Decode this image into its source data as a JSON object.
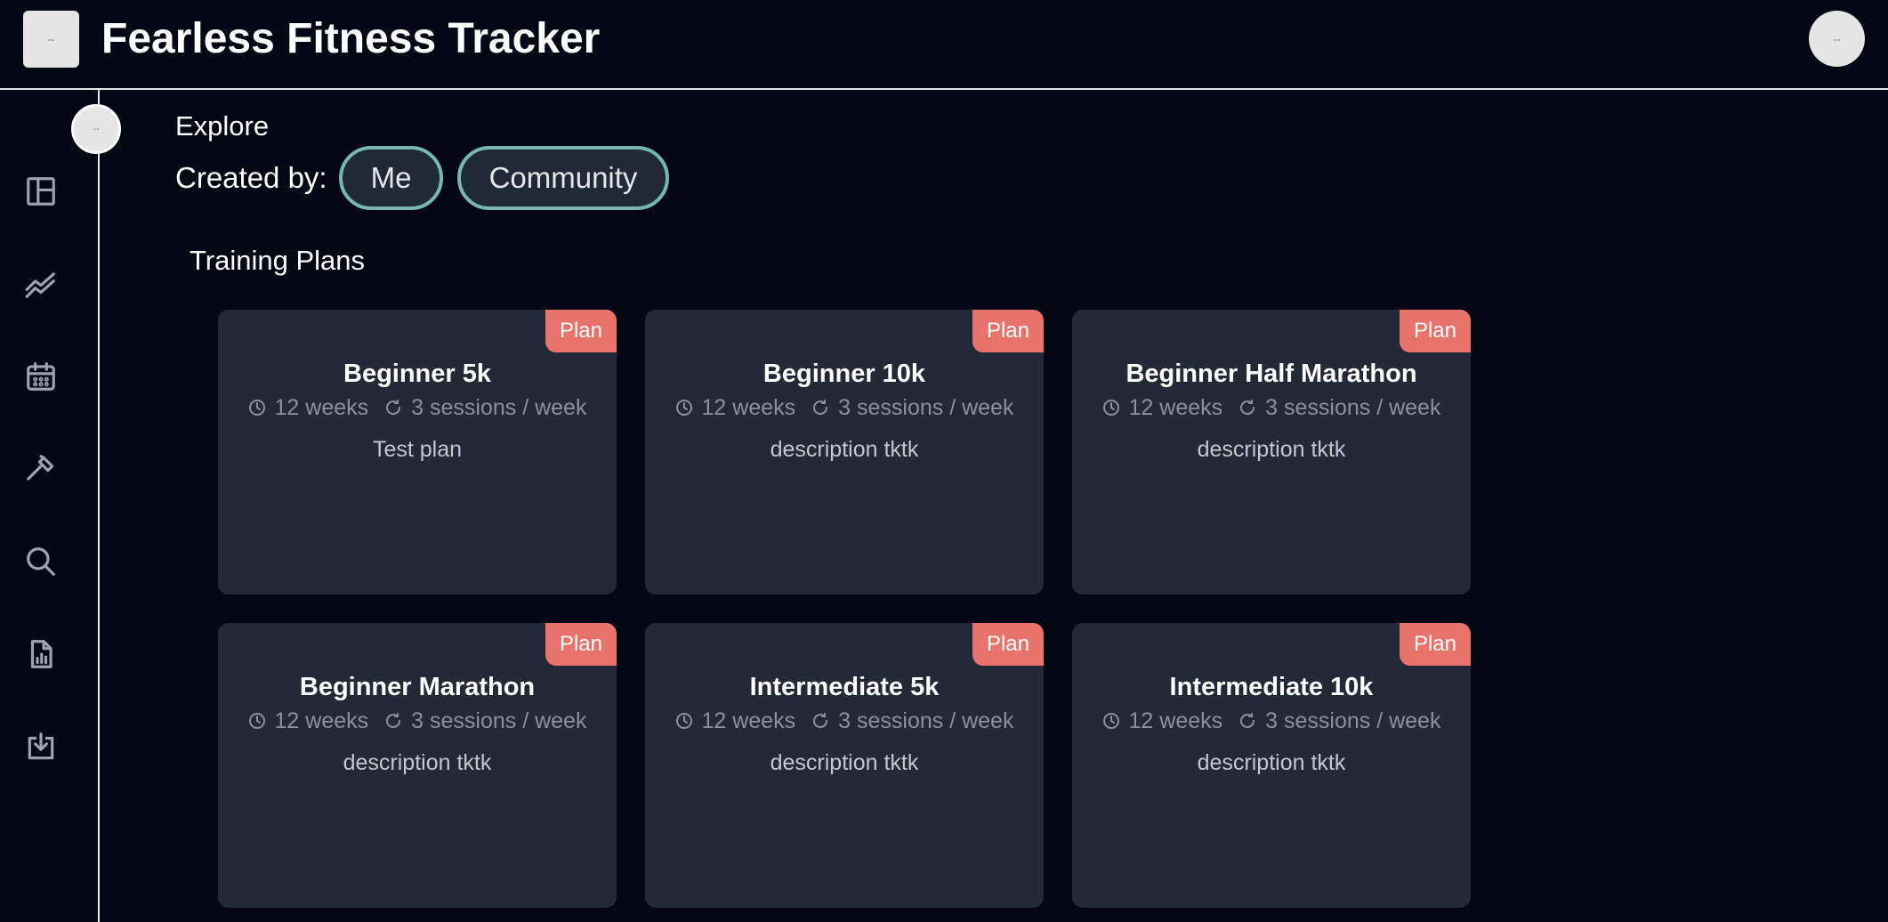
{
  "header": {
    "title": "Fearless Fitness Tracker",
    "menu_button_label": "--",
    "avatar_label": "--"
  },
  "sidebar": {
    "collapse_label": "--",
    "items": [
      {
        "icon": "layout-icon"
      },
      {
        "icon": "trend-chart-icon"
      },
      {
        "icon": "calendar-icon"
      },
      {
        "icon": "hammer-icon"
      },
      {
        "icon": "search-icon"
      },
      {
        "icon": "report-file-icon"
      },
      {
        "icon": "download-icon"
      }
    ]
  },
  "main": {
    "explore_title": "Explore",
    "created_by_label": "Created by:",
    "filters": [
      {
        "label": "Me"
      },
      {
        "label": "Community"
      }
    ],
    "section_title": "Training Plans",
    "plans": [
      {
        "badge": "Plan",
        "title": "Beginner 5k",
        "duration": "12 weeks",
        "frequency": "3 sessions / week",
        "description": "Test plan"
      },
      {
        "badge": "Plan",
        "title": "Beginner 10k",
        "duration": "12 weeks",
        "frequency": "3 sessions / week",
        "description": "description tktk"
      },
      {
        "badge": "Plan",
        "title": "Beginner Half Marathon",
        "duration": "12 weeks",
        "frequency": "3 sessions / week",
        "description": "description tktk"
      },
      {
        "badge": "Plan",
        "title": "Beginner Marathon",
        "duration": "12 weeks",
        "frequency": "3 sessions / week",
        "description": "description tktk"
      },
      {
        "badge": "Plan",
        "title": "Intermediate 5k",
        "duration": "12 weeks",
        "frequency": "3 sessions / week",
        "description": "description tktk"
      },
      {
        "badge": "Plan",
        "title": "Intermediate 10k",
        "duration": "12 weeks",
        "frequency": "3 sessions / week",
        "description": "description tktk"
      }
    ]
  },
  "colors": {
    "background": "#050814",
    "card": "#232936",
    "badge": "#e8736c",
    "filter_border": "#76b7b2"
  }
}
